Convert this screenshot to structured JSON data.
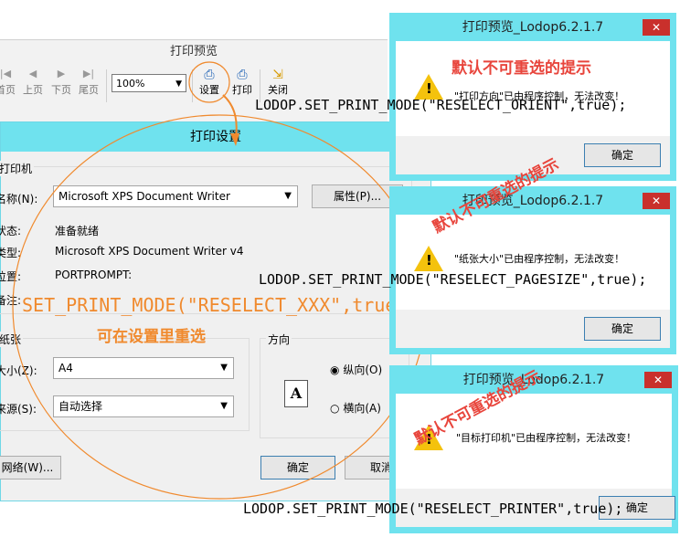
{
  "preview": {
    "title": "打印预览",
    "toolbar": {
      "first": "首页",
      "prev": "上页",
      "next": "下页",
      "last": "尾页",
      "zoom": "100%",
      "setup": "设置",
      "print": "打印",
      "close": "关闭"
    }
  },
  "settings": {
    "title": "打印设置",
    "printer_group": "打印机",
    "name_label": "名称(N):",
    "name_value": "Microsoft XPS Document Writer",
    "properties_button": "属性(P)...",
    "status_label": "状态:",
    "status_value": "准备就绪",
    "type_label": "类型:",
    "type_value": "Microsoft XPS Document Writer v4",
    "where_label": "位置:",
    "where_value": "PORTPROMPT:",
    "comment_label": "备注:",
    "paper_group": "纸张",
    "size_label": "大小(Z):",
    "size_value": "A4",
    "source_label": "来源(S):",
    "source_value": "自动选择",
    "orientation_group": "方向",
    "portrait": "纵向(O)",
    "landscape": "横向(A)",
    "network_button": "网络(W)...",
    "ok_button": "确定",
    "cancel_button": "取消"
  },
  "annotations": {
    "main_code": "SET_PRINT_MODE(\"RESELECT_XXX\",true);",
    "main_note": "可在设置里重选",
    "note_top": "默认不可重选的提示",
    "note_mid": "默认不可重选的提示",
    "note_bottom": "默认不可重选的提示",
    "code_orient": "LODOP.SET_PRINT_MODE(\"RESELECT_ORIENT\",true);",
    "code_pagesize": "LODOP.SET_PRINT_MODE(\"RESELECT_PAGESIZE\",true);",
    "code_printer": "LODOP.SET_PRINT_MODE(\"RESELECT_PRINTER\",true);"
  },
  "dialogs": [
    {
      "title": "打印预览_Lodop6.2.1.7",
      "message": "\"打印方向\"已由程序控制，无法改变！",
      "ok": "确定",
      "close": "✕"
    },
    {
      "title": "打印预览_Lodop6.2.1.7",
      "message": "\"纸张大小\"已由程序控制，无法改变！",
      "ok": "确定",
      "close": "✕"
    },
    {
      "title": "打印预览_Lodop6.2.1.7",
      "message": "\"目标打印机\"已由程序控制，无法改变！",
      "ok": "确定",
      "close": "✕"
    }
  ],
  "colors": {
    "accent": "#6fe2ee",
    "annotation_red": "#e8453c",
    "annotation_orange": "#f08a2e"
  }
}
